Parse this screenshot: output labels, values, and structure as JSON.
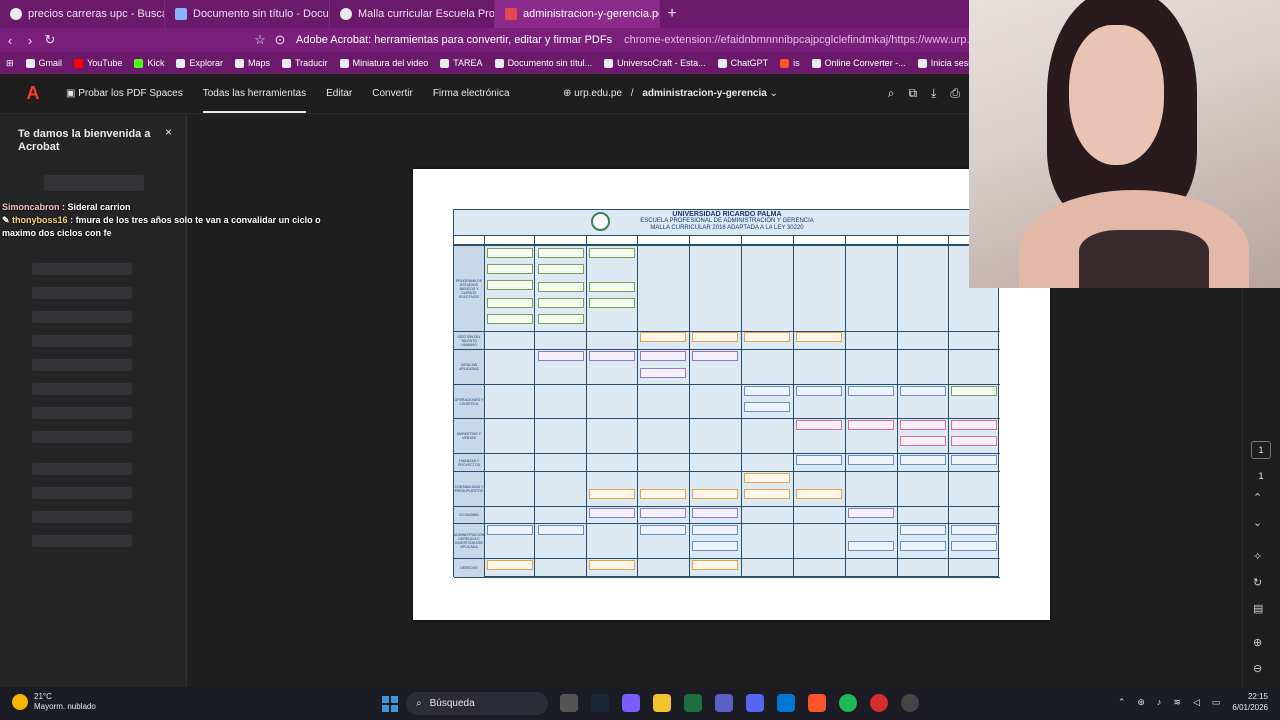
{
  "tabs": [
    {
      "title": "precios carreras upc - Buscar con Go",
      "icon": "google-icon"
    },
    {
      "title": "Documento sin título - Documentos",
      "icon": "docs-icon"
    },
    {
      "title": "Malla curricular Escuela Profesional A",
      "icon": "site-icon"
    },
    {
      "title": "administracion-y-gerencia.pdf",
      "icon": "pdf-icon",
      "active": true
    }
  ],
  "address": {
    "site_label": "Adobe Acrobat: herramientas para convertir, editar y firmar PDFs",
    "url": "chrome-extension://efaidnbmnnnibpcajpcglclefindmkaj/https://www.urp.edu.pe/p..."
  },
  "bookmarks": [
    "Gmail",
    "YouTube",
    "Kick",
    "Explorar",
    "Maps",
    "Traducir",
    "Miniatura del video",
    "TAREA",
    "Documento sin títul...",
    "UniversoCraft - Esta...",
    "ChatGPT",
    "is",
    "Online Converter -...",
    "Inicia sesión: Cuen"
  ],
  "acrobat": {
    "try_spaces": "Probar los PDF Spaces",
    "nav": [
      "Todas las herramientas",
      "Editar",
      "Convertir",
      "Firma electrónica"
    ],
    "domain": "urp.edu.pe",
    "separator": "/",
    "filename": "administracion-y-gerencia"
  },
  "welcome": {
    "title": "Te damos la bienvenida a Acrobat",
    "close": "×"
  },
  "chat": [
    {
      "user": "Simoncabron",
      "sep": " : ",
      "text": "Sideral carrion"
    },
    {
      "user": "thonyboss16",
      "sep": " : ",
      "text": "fmura de los tres años solo te van a convalidar un ciclo o maximo dos ciclos con fe"
    }
  ],
  "pdf": {
    "university": "UNIVERSIDAD RICARDO PALMA",
    "school": "ESCUELA PROFESIONAL DE ADMINISTRACIÓN Y GERENCIA",
    "subtitle": "MALLA CURRICULAR 2016 ADAPTADA A LA LEY 30220",
    "row_labels": [
      "PROGRAMA DE ESTUDIOS BÁSICOS Y CURSOS ELECTIVOS",
      "GESTIÓN DEL TALENTO HUMANO",
      "CIENCIAS APLICADAS",
      "OPERACIONES Y LOGÍSTICA",
      "MARKETING Y VENTAS",
      "FINANZAS Y PROYECTOS",
      "CONTABILIDAD Y PRESUPUESTOS",
      "ECONOMÍA",
      "ADMINISTRACIÓN GERENCIA E INVESTIGACIÓN APLICADA",
      "DERECHO"
    ]
  },
  "pager": {
    "current": "1",
    "total": "1"
  },
  "taskbar": {
    "temp": "21°C",
    "weather": "Mayorm. nublado",
    "search": "Búsqueda",
    "time": "22:15",
    "date": "6/01/2026"
  },
  "colors": {
    "tabbar": "#6b1a6b",
    "acrobat_bg": "#1e1e1e",
    "accent": "#2680eb"
  }
}
